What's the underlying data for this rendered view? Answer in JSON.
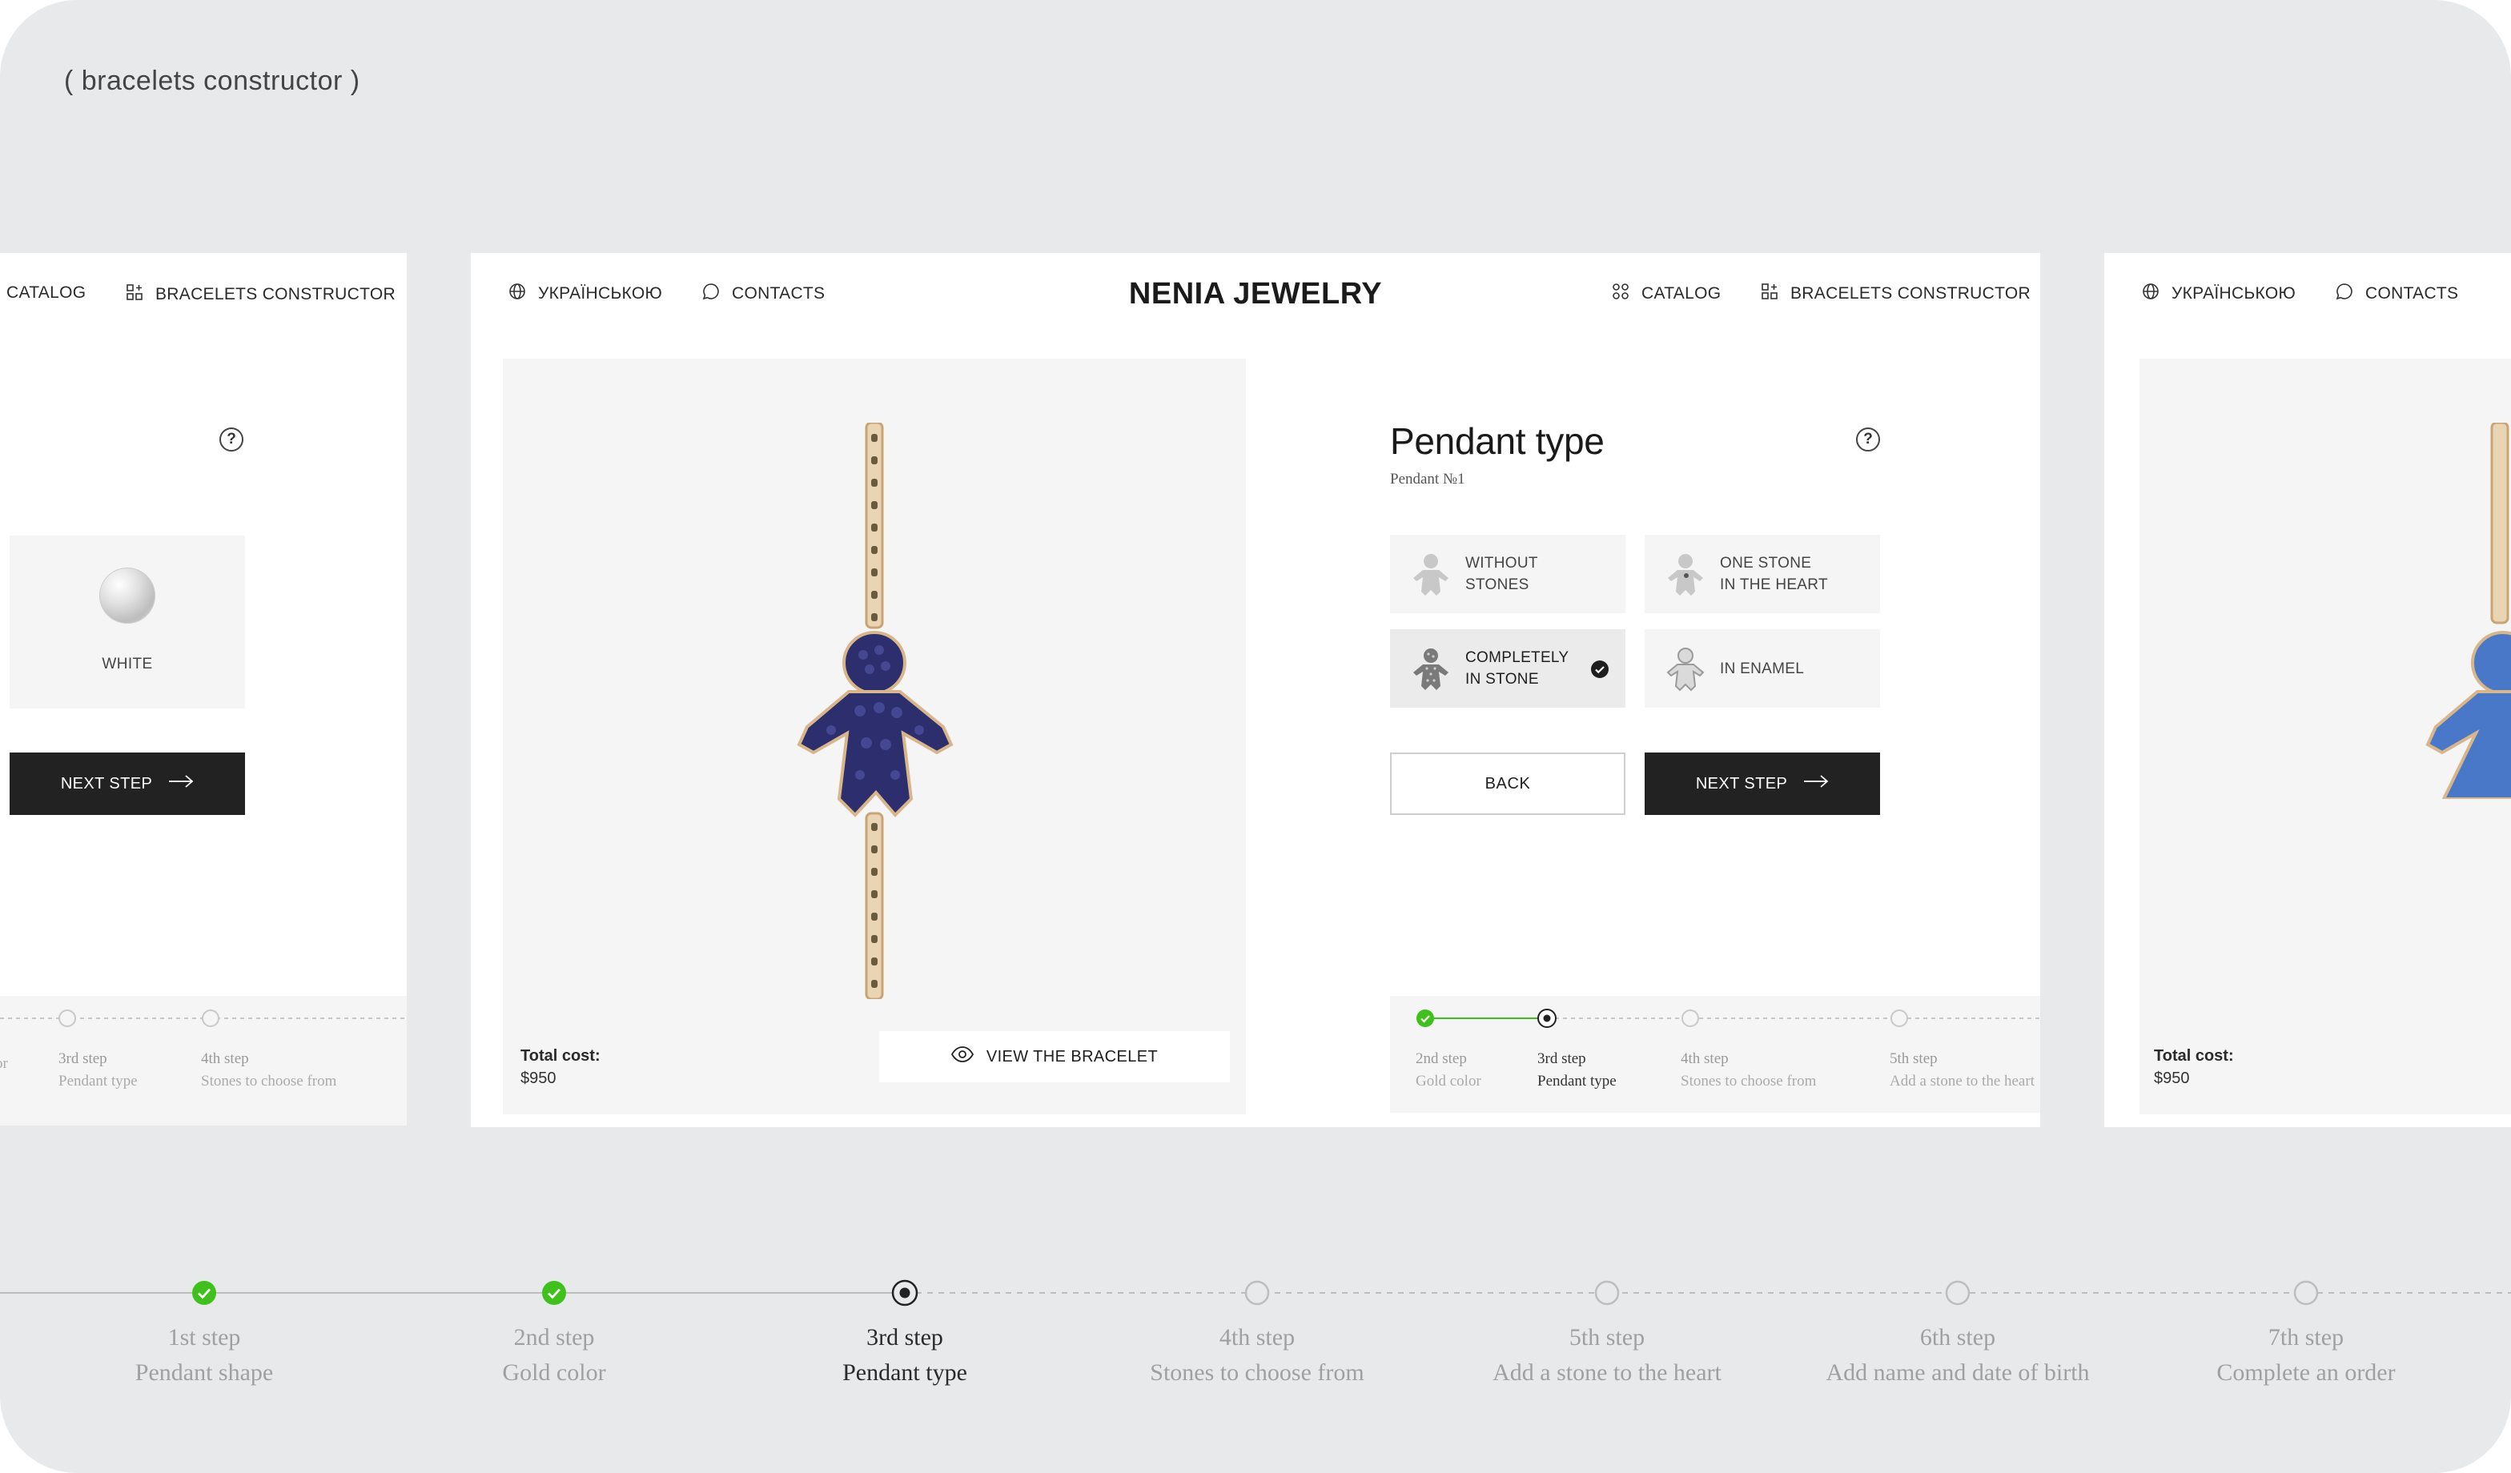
{
  "page": {
    "caption": "( bracelets constructor )"
  },
  "nav": {
    "language": "УКРАЇНСЬКОЮ",
    "contacts": "CONTACTS",
    "brand": "NENIA JEWELRY",
    "catalog": "CATALOG",
    "constructor": "BRACELETS CONSTRUCTOR"
  },
  "left_frame": {
    "swatch_label": "WHITE",
    "next_label": "NEXT STEP",
    "steps": [
      {
        "label": "",
        "name": "or"
      },
      {
        "label": "3rd step",
        "name": "Pendant type"
      },
      {
        "label": "4th step",
        "name": "Stones to choose from"
      }
    ]
  },
  "main_frame": {
    "total_label": "Total cost:",
    "total_value": "$950",
    "view_label": "VIEW THE BRACELET",
    "panel": {
      "title": "Pendant type",
      "subtitle": "Pendant №1",
      "help": "?",
      "options": [
        {
          "line1": "WITHOUT",
          "line2": "STONES",
          "selected": false
        },
        {
          "line1": "ONE STONE",
          "line2": "IN THE HEART",
          "selected": false
        },
        {
          "line1": "COMPLETELY",
          "line2": "IN STONE",
          "selected": true
        },
        {
          "line1": "IN ENAMEL",
          "line2": "",
          "selected": false
        }
      ],
      "back_label": "BACK",
      "next_label": "NEXT STEP"
    },
    "steps": [
      {
        "label": "2nd step",
        "name": "Gold color",
        "status": "done"
      },
      {
        "label": "3rd step",
        "name": "Pendant type",
        "status": "current"
      },
      {
        "label": "4th step",
        "name": "Stones to choose from",
        "status": "pending"
      },
      {
        "label": "5th step",
        "name": "Add a stone to the heart",
        "status": "pending"
      }
    ]
  },
  "right_frame": {
    "total_label": "Total cost:",
    "total_value": "$950"
  },
  "progress": {
    "steps": [
      {
        "label": "1st step",
        "name": "Pendant shape",
        "status": "done"
      },
      {
        "label": "2nd step",
        "name": "Gold color",
        "status": "done"
      },
      {
        "label": "3rd step",
        "name": "Pendant type",
        "status": "current"
      },
      {
        "label": "4th step",
        "name": "Stones to choose from",
        "status": "pending"
      },
      {
        "label": "5th step",
        "name": "Add a stone to the heart",
        "status": "pending"
      },
      {
        "label": "6th step",
        "name": "Add name and date of birth",
        "status": "pending"
      },
      {
        "label": "7th step",
        "name": "Complete an order",
        "status": "pending"
      }
    ]
  },
  "colors": {
    "canvas": "#e8e9eb",
    "done": "#3ec11a",
    "dark_button": "#222222",
    "stone_blue": "#2c2e6e",
    "gold": "#d8b68a"
  }
}
